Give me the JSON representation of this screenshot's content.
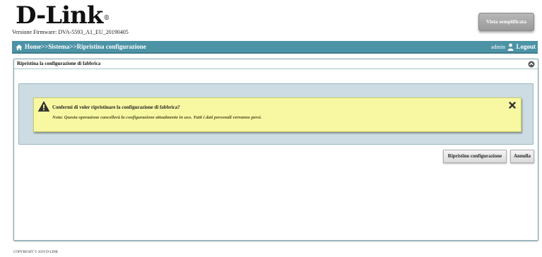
{
  "brand": {
    "logo_text": "D-Link",
    "registered_mark": "®"
  },
  "firmware": "Versione Firmware: DVA-5593_A1_EU_20190405",
  "header": {
    "simple_view_label": "Vista semplificata"
  },
  "navbar": {
    "breadcrumb": "Home>>Sistema>>Ripristina configurazione",
    "user": "admin",
    "logout_label": "Logout",
    "icons": [
      "home-icon",
      "user-icon"
    ]
  },
  "panel": {
    "title": "Ripristina la configurazione di fabbrica",
    "icons": [
      "collapse-icon"
    ]
  },
  "alert": {
    "title": "Confermi di voler ripristinare la configurazione di fabbrica?",
    "note": "Nota: Questa operazione cancellerà la configurazione attualmente in uso. Tutti i dati personali verranno persi.",
    "icons": [
      "warning-icon",
      "close-icon"
    ]
  },
  "actions": {
    "restore_label": "Ripristino configurazione",
    "cancel_label": "Annulla"
  },
  "footer": {
    "copyright": "COPYRIGHT © 2019 D-LINK"
  },
  "colors": {
    "navbar": "#4c93a6",
    "confirm_box": "#ccdce2",
    "alert_bg": "#f8f8a2",
    "simple_button": "#a8a8a8"
  }
}
